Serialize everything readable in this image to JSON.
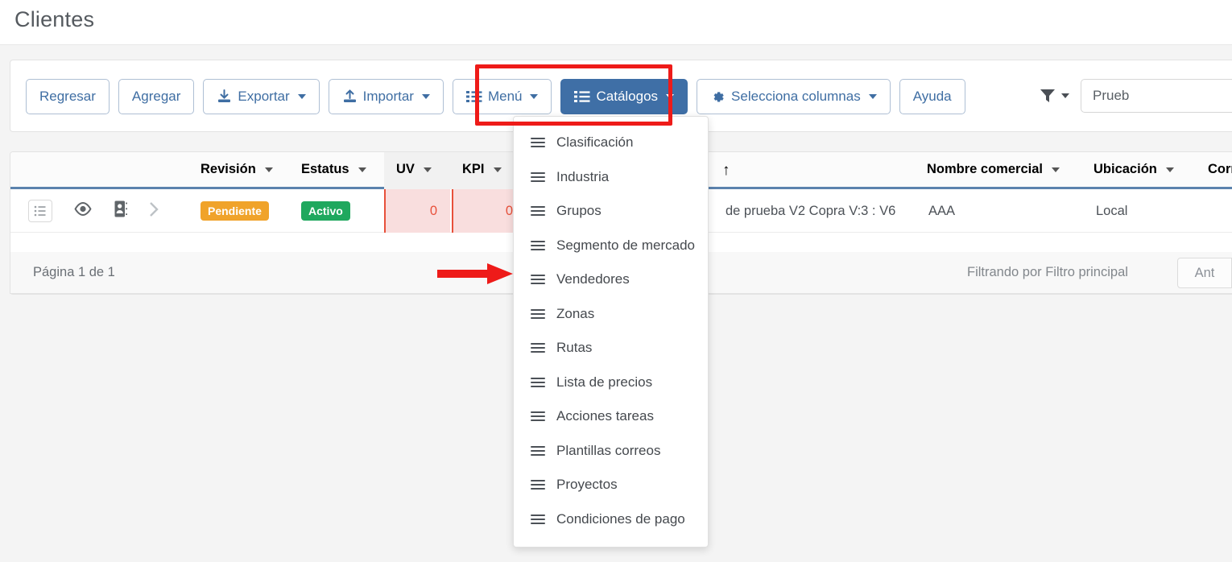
{
  "page": {
    "title": "Clientes"
  },
  "toolbar": {
    "buttons": [
      {
        "label": "Regresar",
        "icon": "none",
        "caret": false,
        "primary": false
      },
      {
        "label": "Agregar",
        "icon": "none",
        "caret": false,
        "primary": false
      },
      {
        "label": "Exportar",
        "icon": "download-icon",
        "caret": true,
        "primary": false
      },
      {
        "label": "Importar",
        "icon": "upload-icon",
        "caret": true,
        "primary": false
      },
      {
        "label": "Menú",
        "icon": "list-icon",
        "caret": true,
        "primary": false
      },
      {
        "label": "Catálogos",
        "icon": "list-icon",
        "caret": true,
        "primary": true
      },
      {
        "label": "Selecciona columnas",
        "icon": "gear-icon",
        "caret": true,
        "primary": false
      },
      {
        "label": "Ayuda",
        "icon": "none",
        "caret": false,
        "primary": false
      }
    ],
    "filter_icon": "funnel-icon",
    "search_value": "Prueb",
    "search_placeholder": "Prueb"
  },
  "catalogs_menu": {
    "open": true,
    "items": [
      {
        "label": "Clasificación",
        "icon": "list-icon"
      },
      {
        "label": "Industria",
        "icon": "list-icon"
      },
      {
        "label": "Grupos",
        "icon": "list-icon"
      },
      {
        "label": "Segmento de mercado",
        "icon": "list-icon"
      },
      {
        "label": "Vendedores",
        "icon": "list-icon"
      },
      {
        "label": "Zonas",
        "icon": "list-icon"
      },
      {
        "label": "Rutas",
        "icon": "list-icon"
      },
      {
        "label": "Lista de precios",
        "icon": "list-icon"
      },
      {
        "label": "Acciones tareas",
        "icon": "list-icon"
      },
      {
        "label": "Plantillas correos",
        "icon": "list-icon"
      },
      {
        "label": "Proyectos",
        "icon": "list-icon"
      },
      {
        "label": "Condiciones de pago",
        "icon": "list-icon"
      }
    ]
  },
  "grid": {
    "columns": [
      {
        "label": "Revisión",
        "sortable": true,
        "sort": "none"
      },
      {
        "label": "Estatus",
        "sortable": true,
        "sort": "none"
      },
      {
        "label": "UV",
        "sortable": true,
        "sort": "none"
      },
      {
        "label": "KPI",
        "sortable": true,
        "sort": "none"
      },
      {
        "label": "",
        "sortable": true,
        "sort": "asc"
      },
      {
        "label": "Nombre comercial",
        "sortable": true,
        "sort": "none"
      },
      {
        "label": "Ubicación",
        "sortable": true,
        "sort": "none"
      },
      {
        "label": "Corre",
        "sortable": false,
        "sort": "none"
      }
    ],
    "row": {
      "revision": "Pendiente",
      "estatus": "Activo",
      "uv": "0",
      "kpi": "0",
      "nombre": "de prueba V2 Copra V:3 : V6",
      "nombre_comercial": "AAA",
      "ubicacion": "Local",
      "actions": [
        "list-icon",
        "eye-icon",
        "contact-card-icon",
        "chevron-right-icon"
      ]
    }
  },
  "footer": {
    "page_info": "Página 1 de 1",
    "filter_info": "Filtrando por Filtro principal",
    "prev_label": "Ant"
  },
  "colors": {
    "primary": "#3f6fa6",
    "badge_pending": "#f0a32a",
    "badge_active": "#1fa85e",
    "alert_red": "#e8503a",
    "annotation_red": "#ee1b19"
  }
}
